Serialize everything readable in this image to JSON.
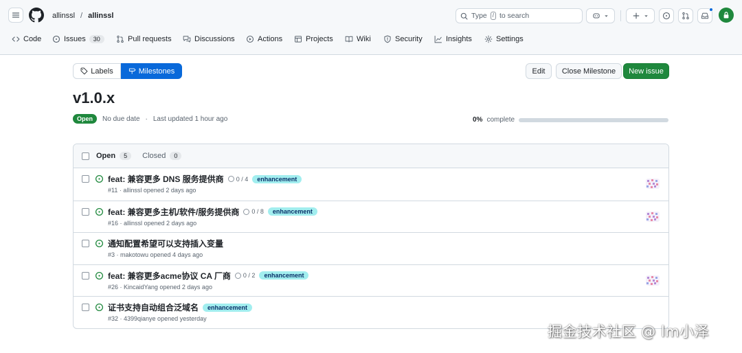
{
  "header": {
    "owner": "allinssl",
    "separator": "/",
    "repo": "allinssl",
    "search": {
      "prefix": "Type",
      "key": "/",
      "suffix": "to search"
    }
  },
  "nav": {
    "items": [
      {
        "label": "Code",
        "icon": "code-icon"
      },
      {
        "label": "Issues",
        "icon": "issue-opened-icon",
        "count": "30"
      },
      {
        "label": "Pull requests",
        "icon": "git-pull-request-icon"
      },
      {
        "label": "Discussions",
        "icon": "comment-discussion-icon"
      },
      {
        "label": "Actions",
        "icon": "play-icon"
      },
      {
        "label": "Projects",
        "icon": "table-icon"
      },
      {
        "label": "Wiki",
        "icon": "book-icon"
      },
      {
        "label": "Security",
        "icon": "shield-icon"
      },
      {
        "label": "Insights",
        "icon": "graph-icon"
      },
      {
        "label": "Settings",
        "icon": "gear-icon"
      }
    ]
  },
  "toolbar": {
    "labels": "Labels",
    "milestones": "Milestones",
    "edit": "Edit",
    "close_milestone": "Close Milestone",
    "new_issue": "New issue"
  },
  "milestone": {
    "title": "v1.0.x",
    "status": "Open",
    "due": "No due date",
    "updated": "Last updated 1 hour ago",
    "percent": "0%",
    "percent_suffix": "complete",
    "progress_fraction": 0
  },
  "issues": {
    "open_label": "Open",
    "open_count": "5",
    "closed_label": "Closed",
    "closed_count": "0",
    "rows": [
      {
        "title": "feat: 兼容更多 DNS 服务提供商",
        "tasks": "0 / 4",
        "label": "enhancement",
        "meta": "#11 · allinssl opened 2 days ago",
        "assignee": true
      },
      {
        "title": "feat: 兼容更多主机/软件/服务提供商",
        "tasks": "0 / 8",
        "label": "enhancement",
        "meta": "#16 · allinssl opened 2 days ago",
        "assignee": true
      },
      {
        "title": "通知配置希望可以支持插入变量",
        "tasks": "",
        "label": "",
        "meta": "#3 · makotowu opened 4 days ago",
        "assignee": false
      },
      {
        "title": "feat: 兼容更多acme协议 CA 厂商",
        "tasks": "0 / 2",
        "label": "enhancement",
        "meta": "#26 · KincaidYang opened 2 days ago",
        "assignee": true
      },
      {
        "title": "证书支持自动组合泛域名",
        "tasks": "",
        "label": "enhancement",
        "meta": "#32 · 4399qianye opened yesterday",
        "assignee": false
      }
    ]
  },
  "watermark": "掘金技术社区 @ lm小泽",
  "colors": {
    "accent": "#0969da",
    "success": "#1f883d",
    "label_enhancement": "#a2eeef"
  }
}
